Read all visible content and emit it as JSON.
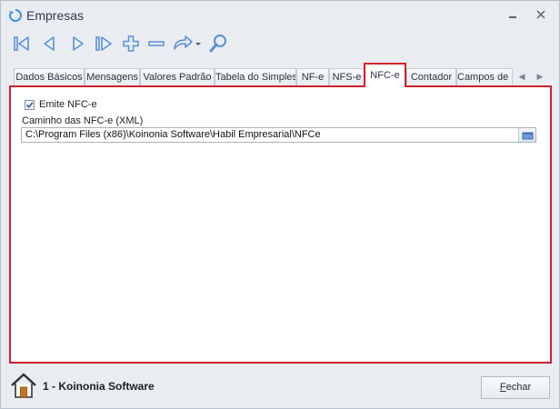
{
  "window": {
    "title": "Empresas",
    "icon": "refresh-icon",
    "controls": {
      "minimize": "▭",
      "close": "✕"
    }
  },
  "toolbar": {
    "buttons": [
      "first-record-icon",
      "previous-record-icon",
      "next-record-icon",
      "last-record-icon",
      "add-icon",
      "remove-icon",
      "undo-icon",
      "search-icon"
    ]
  },
  "tabs": [
    {
      "label": "Dados Básicos"
    },
    {
      "label": "Mensagens"
    },
    {
      "label": "Valores Padrão"
    },
    {
      "label": "Tabela do Simples"
    },
    {
      "label": "NF-e"
    },
    {
      "label": "NFS-e"
    },
    {
      "label": "NFC-e",
      "active": true
    },
    {
      "label": "Contador"
    },
    {
      "label": "Campos de U"
    }
  ],
  "nfce": {
    "emite_label": "Emite NFC-e",
    "emite_checked": true,
    "path_label": "Caminho das NFC-e (XML)",
    "path_value": "C:\\Program Files (x86)\\Koinonia Software\\Habil Empresarial\\NFCe"
  },
  "footer": {
    "company": "1 - Koinonia Software",
    "close_label_first": "F",
    "close_label_rest": "echar"
  },
  "colors": {
    "accent": "#d0222a",
    "toolbar_icon": "#5b8fd6",
    "window_bg": "#e9edf2"
  }
}
